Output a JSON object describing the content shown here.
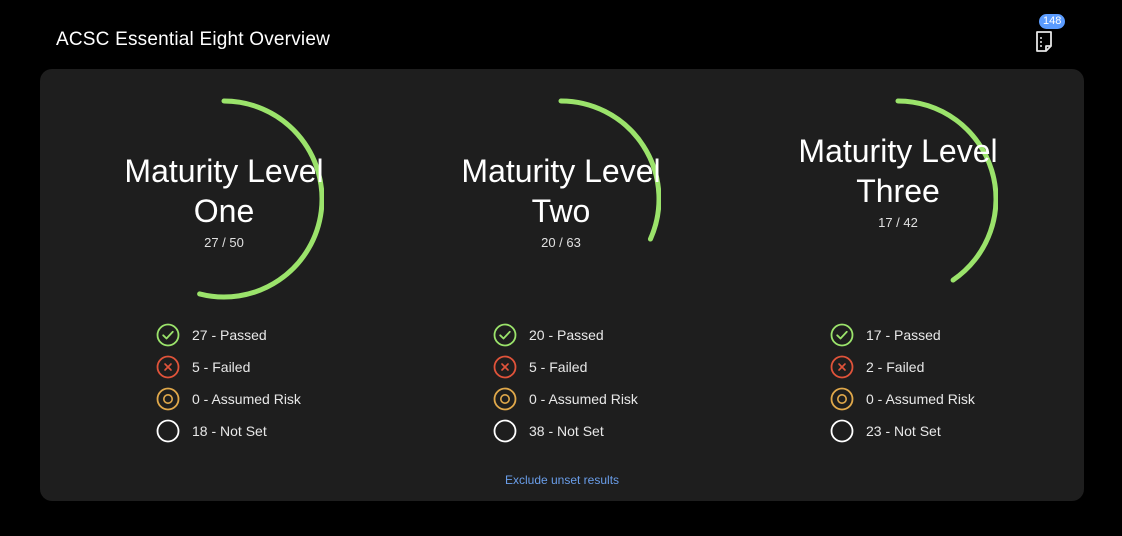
{
  "header": {
    "title": "ACSC Essential Eight Overview",
    "notes_count": "148"
  },
  "colors": {
    "progress_arc": "#9be36b",
    "passed": "#9be36b",
    "failed": "#e0533a",
    "assumed_risk": "#e0a84a",
    "not_set": "#ffffff",
    "badge": "#5b9cff",
    "link": "#6a9eea"
  },
  "levels": [
    {
      "name": "Maturity Level One",
      "score": "27 / 50",
      "progress": 0.54,
      "stats": {
        "passed": "27 - Passed",
        "failed": "5 - Failed",
        "assumed_risk": "0 - Assumed Risk",
        "not_set": "18 - Not Set"
      }
    },
    {
      "name": "Maturity Level Two",
      "score": "20 / 63",
      "progress": 0.317,
      "stats": {
        "passed": "20 - Passed",
        "failed": "5 - Failed",
        "assumed_risk": "0 - Assumed Risk",
        "not_set": "38 - Not Set"
      }
    },
    {
      "name": "Maturity Level Three",
      "score": "17 / 42",
      "progress": 0.405,
      "stats": {
        "passed": "17 - Passed",
        "failed": "2 - Failed",
        "assumed_risk": "0 - Assumed Risk",
        "not_set": "23 - Not Set"
      }
    }
  ],
  "icons": {
    "notes": "notes-icon",
    "passed": "check-circle-icon",
    "failed": "x-circle-icon",
    "assumed_risk": "target-circle-icon",
    "not_set": "empty-circle-icon"
  },
  "footer": {
    "exclude_label": "Exclude unset results"
  }
}
